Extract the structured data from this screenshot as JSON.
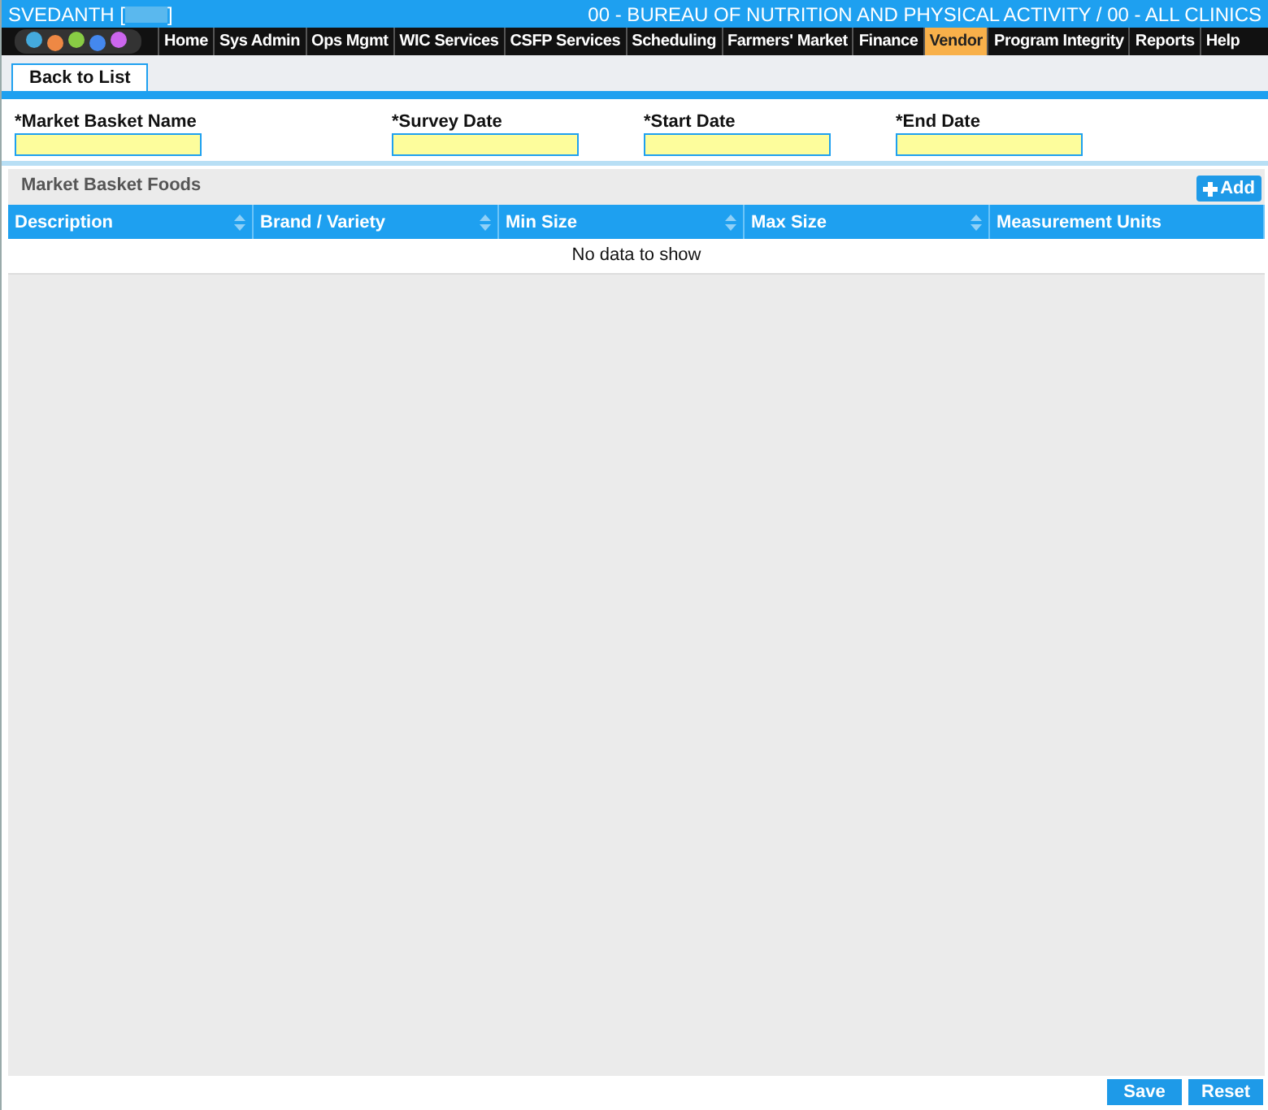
{
  "header": {
    "user": "SVEDANTH [",
    "user_end": "]",
    "agency": "00 - BUREAU OF NUTRITION AND PHYSICAL ACTIVITY / 00 - ALL CLINICS"
  },
  "menu": [
    {
      "label": "Home",
      "selected": false
    },
    {
      "label": "Sys Admin",
      "selected": false
    },
    {
      "label": "Ops Mgmt",
      "selected": false
    },
    {
      "label": "WIC Services",
      "selected": false
    },
    {
      "label": "CSFP Services",
      "selected": false
    },
    {
      "label": "Scheduling",
      "selected": false
    },
    {
      "label": "Farmers' Market",
      "selected": false
    },
    {
      "label": "Finance",
      "selected": false
    },
    {
      "label": "Vendor",
      "selected": true
    },
    {
      "label": "Program Integrity",
      "selected": false
    },
    {
      "label": "Reports",
      "selected": false
    },
    {
      "label": "Help",
      "selected": false
    }
  ],
  "back_tab": "Back to List",
  "fields": [
    {
      "label": "*Market Basket Name"
    },
    {
      "label": "*Survey Date"
    },
    {
      "label": "*Start Date"
    },
    {
      "label": "*End Date"
    }
  ],
  "grid": {
    "title": "Market Basket Foods",
    "add_button": "Add",
    "columns": [
      {
        "label": "Description",
        "sortable": true
      },
      {
        "label": "Brand / Variety",
        "sortable": true
      },
      {
        "label": "Min Size",
        "sortable": true
      },
      {
        "label": "Max Size",
        "sortable": true
      },
      {
        "label": "Measurement Units",
        "sortable": false
      }
    ],
    "empty": "No data to show"
  },
  "buttons": [
    "Save",
    "Reset"
  ]
}
